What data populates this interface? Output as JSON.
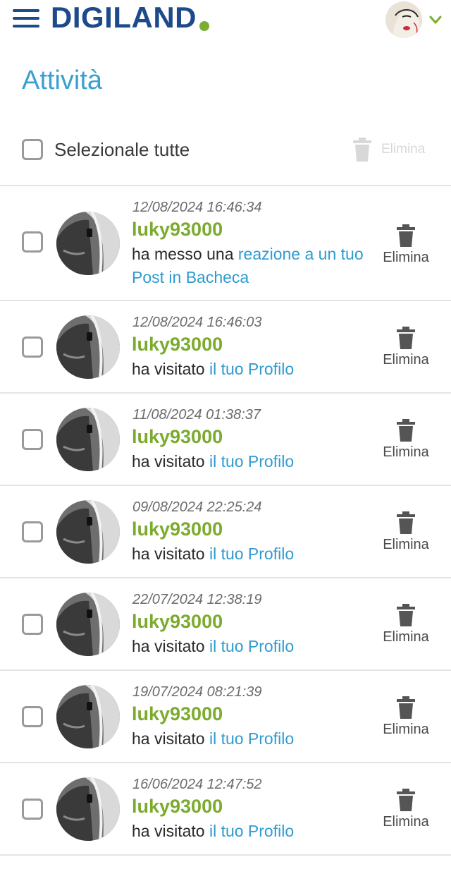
{
  "header": {
    "logo_text": "DIGILAND",
    "brand_blue": "#1c4a8a",
    "brand_green": "#7dae31"
  },
  "title": "Attività",
  "select_all": {
    "label": "Selezionale tutte",
    "delete_label": "Elimina"
  },
  "activities": [
    {
      "timestamp": "12/08/2024 16:46:34",
      "user": "luky93000",
      "prefix": "ha messo una",
      "link": "reazione a un tuo Post in Bacheca",
      "delete_label": "Elimina"
    },
    {
      "timestamp": "12/08/2024 16:46:03",
      "user": "luky93000",
      "prefix": "ha visitato",
      "link": "il tuo Profilo",
      "delete_label": "Elimina"
    },
    {
      "timestamp": "11/08/2024 01:38:37",
      "user": "luky93000",
      "prefix": "ha visitato",
      "link": "il tuo Profilo",
      "delete_label": "Elimina"
    },
    {
      "timestamp": "09/08/2024 22:25:24",
      "user": "luky93000",
      "prefix": "ha visitato",
      "link": "il tuo Profilo",
      "delete_label": "Elimina"
    },
    {
      "timestamp": "22/07/2024 12:38:19",
      "user": "luky93000",
      "prefix": "ha visitato",
      "link": "il tuo Profilo",
      "delete_label": "Elimina"
    },
    {
      "timestamp": "19/07/2024 08:21:39",
      "user": "luky93000",
      "prefix": "ha visitato",
      "link": "il tuo Profilo",
      "delete_label": "Elimina"
    },
    {
      "timestamp": "16/06/2024 12:47:52",
      "user": "luky93000",
      "prefix": "ha visitato",
      "link": "il tuo Profilo",
      "delete_label": "Elimina"
    }
  ],
  "colors": {
    "title": "#3aa0d0",
    "username": "#7aab2d",
    "link": "#2f9bd0"
  }
}
